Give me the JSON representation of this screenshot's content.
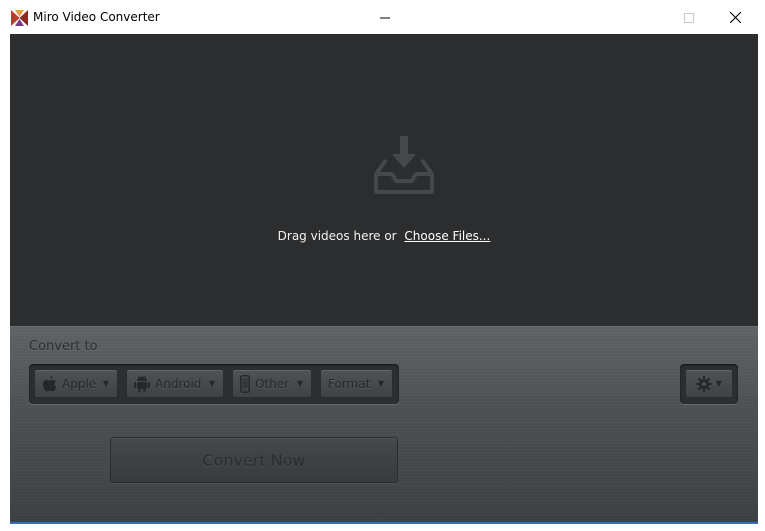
{
  "window": {
    "title": "Miro Video Converter",
    "icon": "miro-logo-icon",
    "controls": [
      "minimize-icon",
      "maximize-icon",
      "close-icon"
    ]
  },
  "dropzone": {
    "icon": "inbox-download-icon",
    "prompt": "Drag videos here or",
    "choose_link": "Choose Files..."
  },
  "convert": {
    "label": "Convert to",
    "devices": [
      {
        "label": "Apple",
        "icon": "apple-icon"
      },
      {
        "label": "Android",
        "icon": "android-icon"
      },
      {
        "label": "Other",
        "icon": "phone-icon"
      },
      {
        "label": "Format",
        "icon": ""
      }
    ],
    "settings_icon": "gear-icon",
    "convert_button": "Convert Now"
  },
  "colors": {
    "dropzone_bg": "#2b2d2f",
    "panel_bg": "#4b4f51",
    "accent": "#2f6fb5"
  }
}
